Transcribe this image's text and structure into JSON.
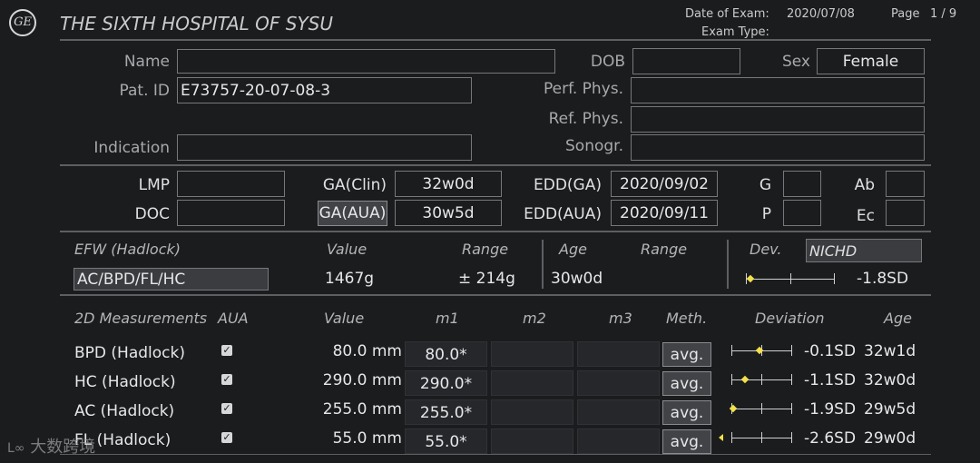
{
  "header": {
    "logo_text": "GE",
    "hospital": "THE SIXTH HOSPITAL OF SYSU",
    "date_label": "Date of Exam:",
    "date_value": "2020/07/08",
    "page_label": "Page",
    "page_value": "1 / 9",
    "exam_type_label": "Exam Type:"
  },
  "patient": {
    "name_label": "Name",
    "name_value": "",
    "dob_label": "DOB",
    "dob_value": "",
    "sex_label": "Sex",
    "sex_value": "Female",
    "patid_label": "Pat. ID",
    "patid_value": "E73757-20-07-08-3",
    "perf_label": "Perf. Phys.",
    "perf_value": "",
    "ref_label": "Ref. Phys.",
    "ref_value": "",
    "indication_label": "Indication",
    "indication_value": "",
    "sonogr_label": "Sonogr.",
    "sonogr_value": ""
  },
  "dating": {
    "lmp_label": "LMP",
    "lmp_value": "",
    "doc_label": "DOC",
    "doc_value": "",
    "ga_clin_label": "GA(Clin)",
    "ga_clin_value": "32w0d",
    "ga_aua_label": "GA(AUA)",
    "ga_aua_value": "30w5d",
    "edd_ga_label": "EDD(GA)",
    "edd_ga_value": "2020/09/02",
    "edd_aua_label": "EDD(AUA)",
    "edd_aua_value": "2020/09/11",
    "g_label": "G",
    "g_value": "",
    "p_label": "P",
    "p_value": "",
    "ab_label": "Ab",
    "ab_value": "",
    "ec_label": "Ec",
    "ec_value": ""
  },
  "efw": {
    "title": "EFW (Hadlock)",
    "value_header": "Value",
    "range_header": "Range",
    "age_header": "Age",
    "age_range_header": "Range",
    "dev_header": "Dev.",
    "dev_ref": "NICHD",
    "formula": "AC/BPD/FL/HC",
    "value": "1467g",
    "range": "± 214g",
    "age": "30w0d",
    "deviation": "-1.8SD",
    "deviation_sd": -1.8
  },
  "measurements": {
    "headers": {
      "title": "2D Measurements",
      "aua": "AUA",
      "value": "Value",
      "m1": "m1",
      "m2": "m2",
      "m3": "m3",
      "meth": "Meth.",
      "deviation": "Deviation",
      "age": "Age"
    },
    "rows": [
      {
        "name": "BPD (Hadlock)",
        "aua": true,
        "value": "80.0 mm",
        "m1": "80.0*",
        "m2": "",
        "m3": "",
        "meth": "avg.",
        "deviation": "-0.1SD",
        "deviation_sd": -0.1,
        "age": "32w1d"
      },
      {
        "name": "HC (Hadlock)",
        "aua": true,
        "value": "290.0 mm",
        "m1": "290.0*",
        "m2": "",
        "m3": "",
        "meth": "avg.",
        "deviation": "-1.1SD",
        "deviation_sd": -1.1,
        "age": "32w0d"
      },
      {
        "name": "AC (Hadlock)",
        "aua": true,
        "value": "255.0 mm",
        "m1": "255.0*",
        "m2": "",
        "m3": "",
        "meth": "avg.",
        "deviation": "-1.9SD",
        "deviation_sd": -1.9,
        "age": "29w5d"
      },
      {
        "name": "FL (Hadlock)",
        "aua": true,
        "value": "55.0 mm",
        "m1": "55.0*",
        "m2": "",
        "m3": "",
        "meth": "avg.",
        "deviation": "-2.6SD",
        "deviation_sd": -2.6,
        "age": "29w0d"
      }
    ]
  },
  "watermark": {
    "text": "大数跨境"
  },
  "colors": {
    "background": "#1b1c1e",
    "marker": "#f2e14a",
    "border": "#76787b"
  }
}
